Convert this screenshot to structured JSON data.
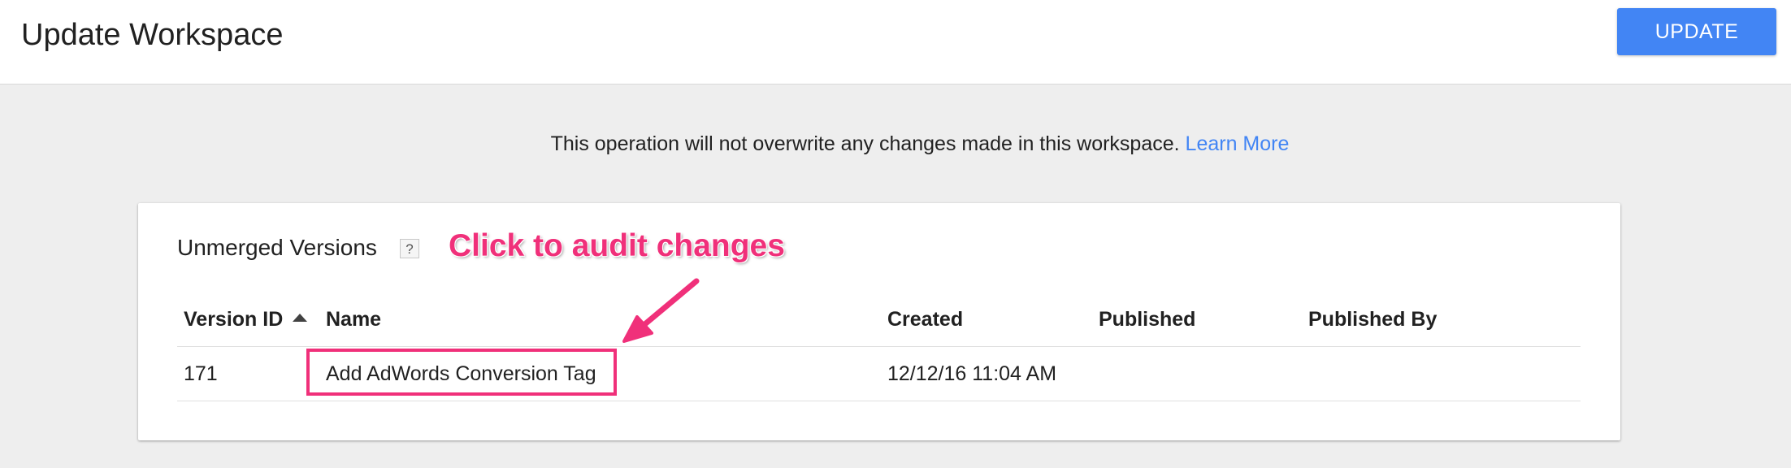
{
  "header": {
    "title": "Update Workspace",
    "update_label": "UPDATE"
  },
  "notice": {
    "text": "This operation will not overwrite any changes made in this workspace.",
    "link": "Learn More"
  },
  "card": {
    "title": "Unmerged Versions",
    "help_glyph": "?",
    "annotation": "Click to audit changes"
  },
  "table": {
    "columns": [
      "Version ID",
      "Name",
      "Created",
      "Published",
      "Published By"
    ],
    "rows": [
      {
        "version_id": "171",
        "name": "Add AdWords Conversion Tag",
        "created": "12/12/16 11:04 AM",
        "published": "",
        "published_by": ""
      }
    ]
  },
  "colors": {
    "accent": "#4285f4",
    "annotation": "#f0307a",
    "background": "#eeeeee"
  },
  "icons": {
    "help": "question-mark-icon",
    "sort": "sort-ascending-icon"
  }
}
